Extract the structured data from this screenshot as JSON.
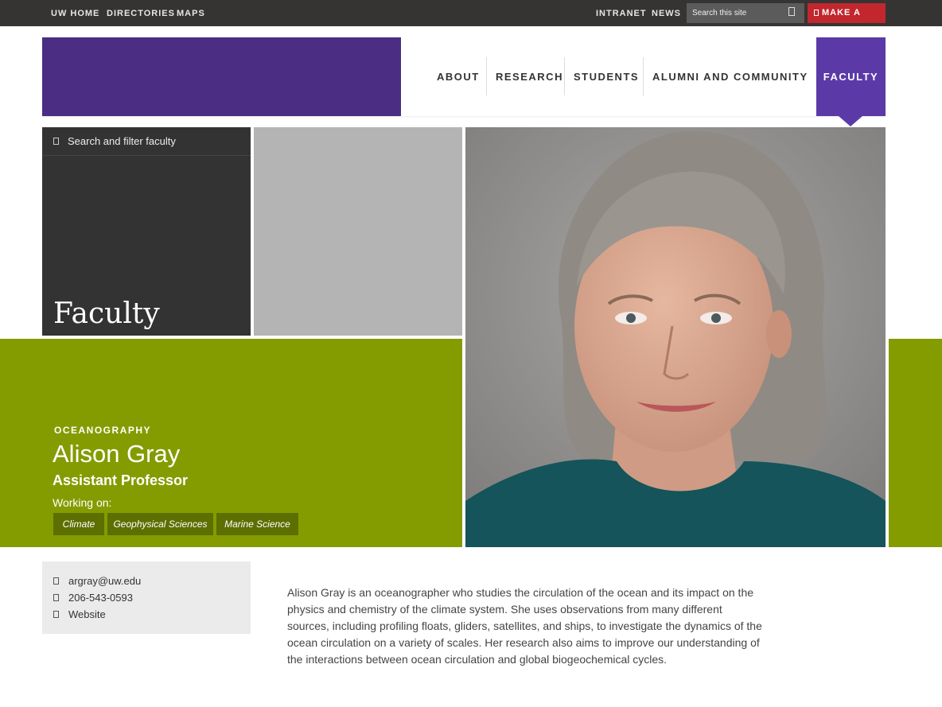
{
  "topbar": {
    "links": [
      "UW HOME",
      "DIRECTORIES",
      "MAPS"
    ],
    "right_links": [
      "INTRANET",
      "NEWS"
    ],
    "search_placeholder": "Search this site",
    "gift_label": "MAKE A GIFT"
  },
  "nav": {
    "items": [
      "ABOUT",
      "RESEARCH",
      "STUDENTS",
      "ALUMNI AND COMMUNITY"
    ],
    "active": "FACULTY"
  },
  "hero": {
    "filter_label": "Search and filter faculty",
    "page_title": "Faculty"
  },
  "profile": {
    "department": "OCEANOGRAPHY",
    "name": "Alison Gray",
    "title": "Assistant Professor",
    "working_on_label": "Working on:",
    "tags": [
      "Climate",
      "Geophysical Sciences",
      "Marine Science"
    ]
  },
  "contact": {
    "email": "argray@uw.edu",
    "phone": "206-543-0593",
    "website": "Website"
  },
  "bio": "Alison Gray is an oceanographer who studies the circulation of the ocean and its impact on the physics and chemistry of the climate system. She uses observations from many different sources, including profiling floats, gliders, satellites, and ships, to investigate the dynamics of the ocean circulation on a variety of scales. Her research also aims to improve our understanding of the interactions between ocean circulation and global biogeochemical cycles.",
  "colors": {
    "topbar": "#363433",
    "brand_purple": "#4b2e83",
    "nav_active": "#5b3aa8",
    "gift_red": "#c1272d",
    "green": "#849c00",
    "tag_green": "#5c6f00",
    "dark_panel": "#333333"
  }
}
